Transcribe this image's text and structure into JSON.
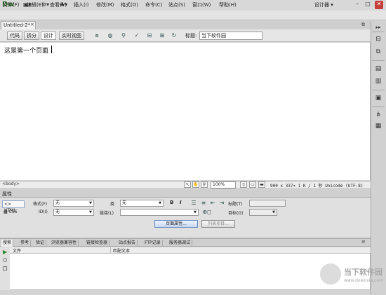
{
  "app": {
    "logo": "Dw",
    "workspace": "设计器 ▾"
  },
  "menu": [
    "文件(F)",
    "编辑(E)",
    "查看(V)",
    "插入(I)",
    "修改(M)",
    "格式(O)",
    "命令(C)",
    "站点(S)",
    "窗口(W)",
    "帮助(H)"
  ],
  "document": {
    "tab": "Untitled-2*",
    "content": "这是第一个页面"
  },
  "doc_toolbar": {
    "views": [
      "代码",
      "拆分",
      "设计",
      "实时视图"
    ],
    "title_label": "标题:",
    "title_value": "当下软件园"
  },
  "status": {
    "tag": "<body>",
    "zoom": "100%",
    "info": "900 x 337▾ 1 K / 1 秒 Unicode (UTF-8)"
  },
  "properties": {
    "header": "属性",
    "html_btn": "HTML",
    "css_btn": "CSS",
    "format_label": "格式(F)",
    "format_value": "无",
    "id_label": "ID(I)",
    "id_value": "无",
    "class_label": "类",
    "class_value": "无",
    "link_label": "链接(L)",
    "title_label": "标题(T)",
    "target_label": "目标(G)",
    "bold": "B",
    "italic": "I",
    "page_props": "页面属性...",
    "list_item": "列表项目..."
  },
  "results": {
    "tabs": [
      "搜索",
      "参考",
      "验证",
      "浏览器兼容性",
      "链接检查器",
      "站点报告",
      "FTP记录",
      "服务器调试"
    ],
    "col_file": "文件",
    "col_match": "匹配文本"
  },
  "watermark": {
    "name": "当下软件园",
    "url": "www.downxia.com"
  }
}
